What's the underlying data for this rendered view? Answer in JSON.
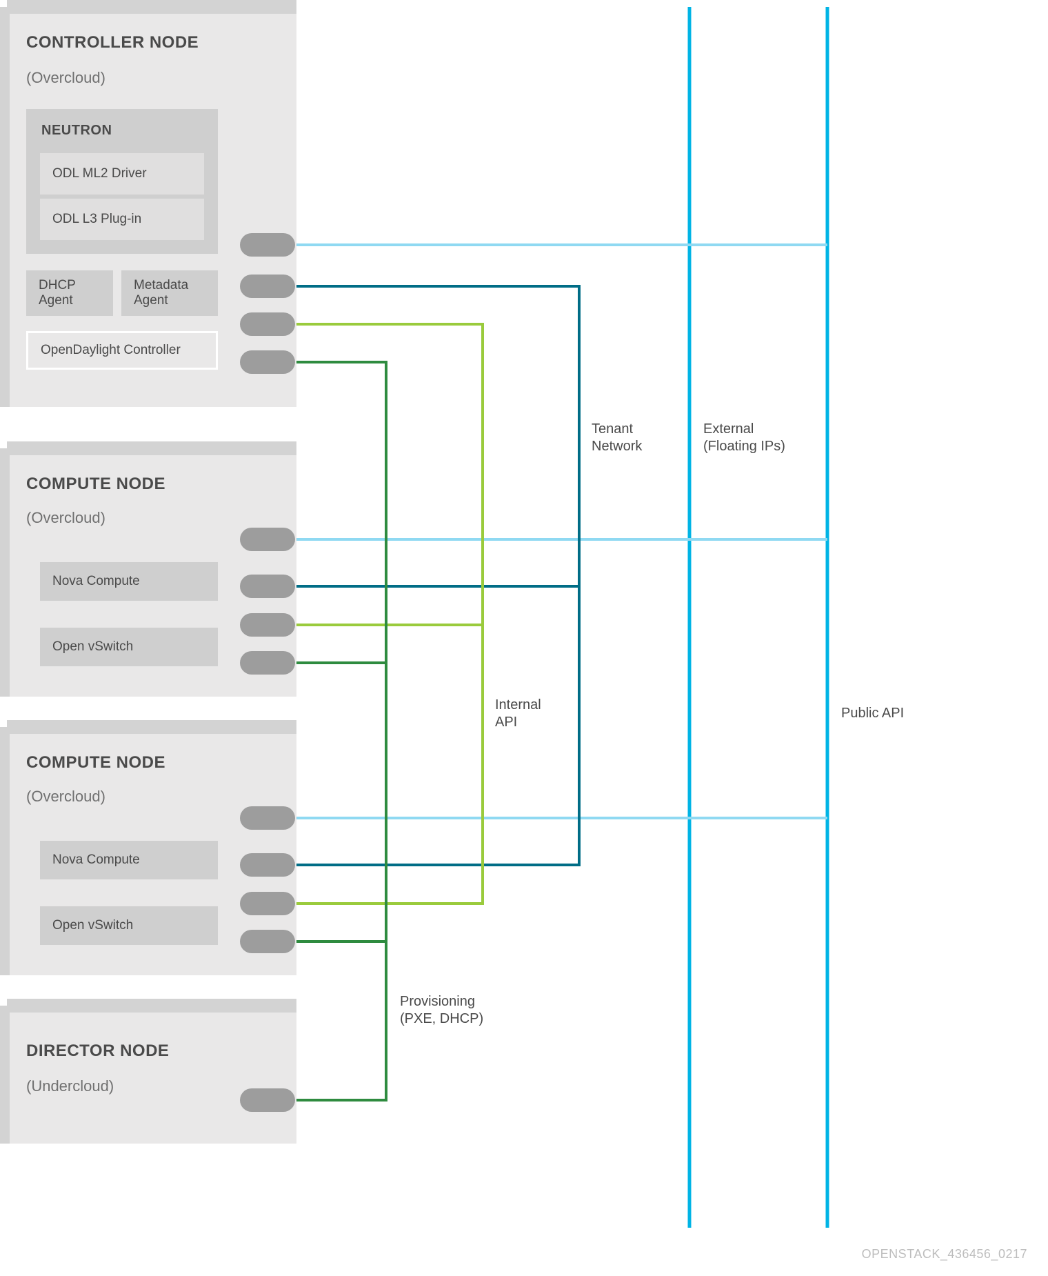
{
  "colors": {
    "publicApi": "#00B4E5",
    "external": "#00B4E5",
    "externalBranch": "#8FD9F2",
    "tenant": "#006D86",
    "internal": "#9ACB3C",
    "provisioning": "#2E8B3F"
  },
  "nodes": {
    "controller": {
      "title": "CONTROLLER NODE",
      "subtitle": "(Overcloud)",
      "neutron": {
        "title": "NEUTRON",
        "ml2": "ODL ML2 Driver",
        "l3": "ODL L3 Plug-in"
      },
      "dhcp": "DHCP\nAgent",
      "metadata": "Metadata\nAgent",
      "odl": "OpenDaylight Controller"
    },
    "compute1": {
      "title": "COMPUTE NODE",
      "subtitle": "(Overcloud)",
      "nova": "Nova Compute",
      "ovs": "Open vSwitch"
    },
    "compute2": {
      "title": "COMPUTE NODE",
      "subtitle": "(Overcloud)",
      "nova": "Nova Compute",
      "ovs": "Open vSwitch"
    },
    "director": {
      "title": "DIRECTOR NODE",
      "subtitle": "(Undercloud)"
    }
  },
  "labels": {
    "tenant": "Tenant\nNetwork",
    "external": "External\n(Floating IPs)",
    "internal": "Internal\nAPI",
    "provisioning": "Provisioning\n(PXE, DHCP)",
    "publicApi": "Public API"
  },
  "footer": "OPENSTACK_436456_0217"
}
